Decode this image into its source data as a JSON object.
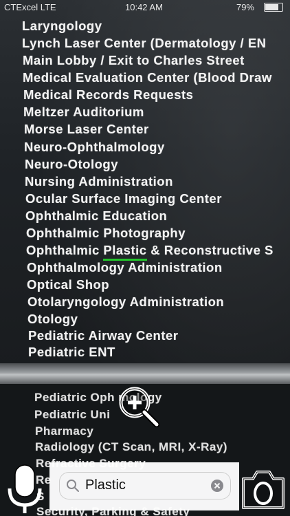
{
  "status_bar": {
    "carrier": "CTExcel LTE",
    "time": "10:42 AM",
    "battery": "79%"
  },
  "directory": {
    "lines": [
      "Laryngology",
      "Lynch Laser Center (Dermatology / EN",
      "Main Lobby / Exit to Charles Street",
      "Medical Evaluation Center (Blood Draw",
      "Medical Records Requests",
      "Meltzer Auditorium",
      "Morse Laser Center",
      "Neuro-Ophthalmology",
      "Neuro-Otology",
      "Nursing Administration",
      "Ocular Surface Imaging Center",
      "Ophthalmic Education",
      "Ophthalmic Photography",
      "Ophthalmology Administration",
      "Optical Shop",
      "Otolaryngology Administration",
      "Otology",
      "Pediatric Airway Center",
      "Pediatric ENT"
    ],
    "highlight_line": {
      "before": "Ophthalmic ",
      "match": "Plastic",
      "after": " & Reconstructive S"
    },
    "lower_lines": [
      "Pediatric Oph     mology",
      "Pediatric Uni",
      "Pharmacy",
      "Radiology (CT Scan, MRI, X-Ray)",
      "Refractive Surgery",
      "Re",
      "S",
      "Security, Parking & Safety"
    ]
  },
  "search": {
    "query": "Plastic"
  },
  "icons": {
    "mic": "microphone-icon",
    "search": "search-icon",
    "clear": "clear-icon",
    "camera": "camera-icon",
    "zoom": "zoom-in-icon"
  },
  "colors": {
    "highlight": "#22c52a"
  }
}
